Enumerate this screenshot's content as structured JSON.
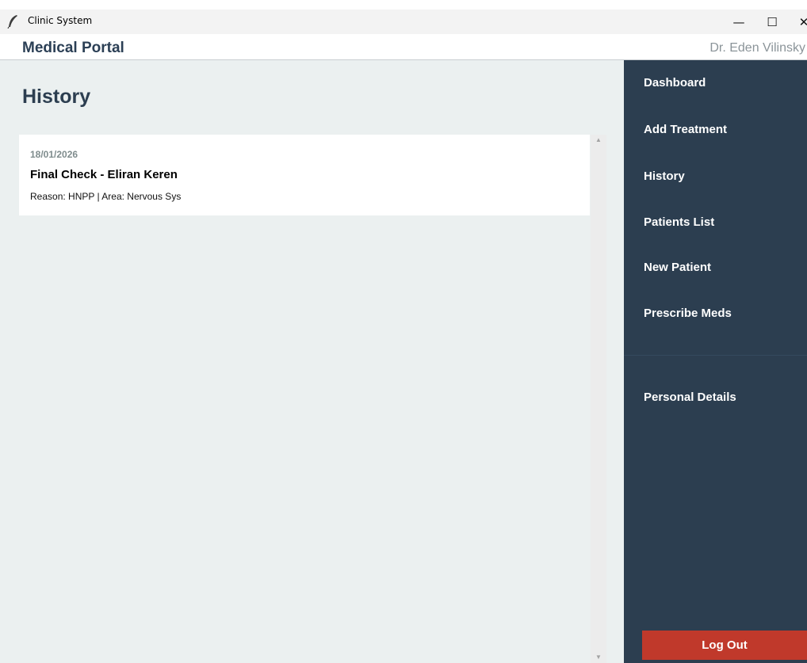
{
  "window": {
    "title": "Clinic System",
    "controls": {
      "minimize": "—",
      "maximize": "☐",
      "close": "✕"
    }
  },
  "header": {
    "portal_title": "Medical Portal",
    "user_name": "Dr. Eden Vilinsky"
  },
  "main": {
    "page_title": "History",
    "entries": [
      {
        "date": "18/01/2026",
        "title": "Final Check - Eliran Keren",
        "details": "Reason: HNPP | Area: Nervous Sys"
      }
    ]
  },
  "sidebar": {
    "items": [
      {
        "label": "Dashboard"
      },
      {
        "label": "Add Treatment"
      },
      {
        "label": "History"
      },
      {
        "label": "Patients List"
      },
      {
        "label": "New Patient"
      },
      {
        "label": "Prescribe Meds"
      }
    ],
    "secondary_items": [
      {
        "label": "Personal Details"
      }
    ],
    "logout_label": "Log Out"
  },
  "colors": {
    "sidebar_bg": "#2c3e50",
    "main_bg": "#ebf0f0",
    "logout_bg": "#c0392b",
    "heading": "#2c3e50",
    "muted": "#7f8c8d"
  },
  "icons": {
    "app": "feather-icon",
    "scroll_up": "scroll-up-arrow-icon",
    "scroll_down": "scroll-down-arrow-icon"
  }
}
